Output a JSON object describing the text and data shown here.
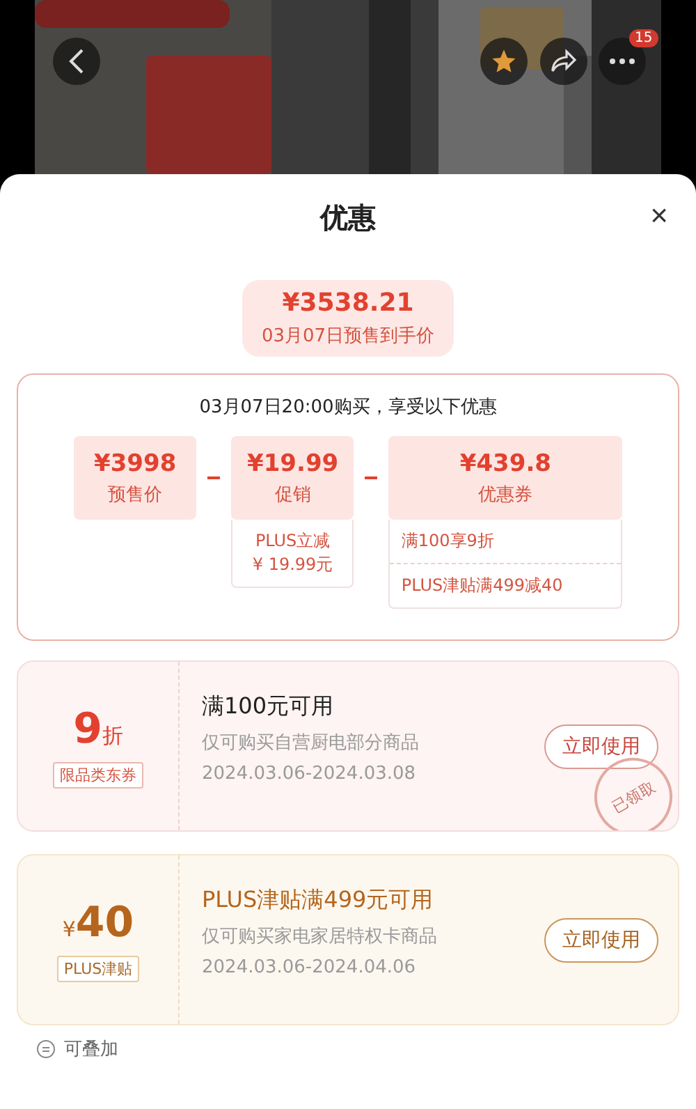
{
  "header": {
    "badge": "15"
  },
  "sheet": {
    "title": "优惠",
    "close": "×"
  },
  "final_price": {
    "amount": "¥3538.21",
    "caption": "03月07日预售到手价"
  },
  "breakdown": {
    "heading": "03月07日20:00购买，享受以下优惠",
    "items": [
      {
        "amount": "¥3998",
        "label": "预售价"
      },
      {
        "amount": "¥19.99",
        "label": "促销",
        "details": [
          "PLUS立减\n¥ 19.99元"
        ]
      },
      {
        "amount": "¥439.8",
        "label": "优惠券",
        "details": [
          "满100享9折",
          "PLUS津贴满499减40"
        ]
      }
    ]
  },
  "coupons": [
    {
      "kind": "discount",
      "value": "9",
      "unit": "折",
      "tag": "限品类东券",
      "title": "满100元可用",
      "scope": "仅可购买自营厨电部分商品",
      "period": "2024.03.06-2024.03.08",
      "button": "立即使用",
      "stamp": "已领取"
    },
    {
      "kind": "plus",
      "prefix": "¥",
      "value": "40",
      "tag": "PLUS津贴",
      "title": "PLUS津贴满499元可用",
      "scope": "仅可购买家电家居特权卡商品",
      "period": "2024.03.06-2024.04.06",
      "button": "立即使用"
    }
  ],
  "footer": {
    "note": "可叠加"
  }
}
